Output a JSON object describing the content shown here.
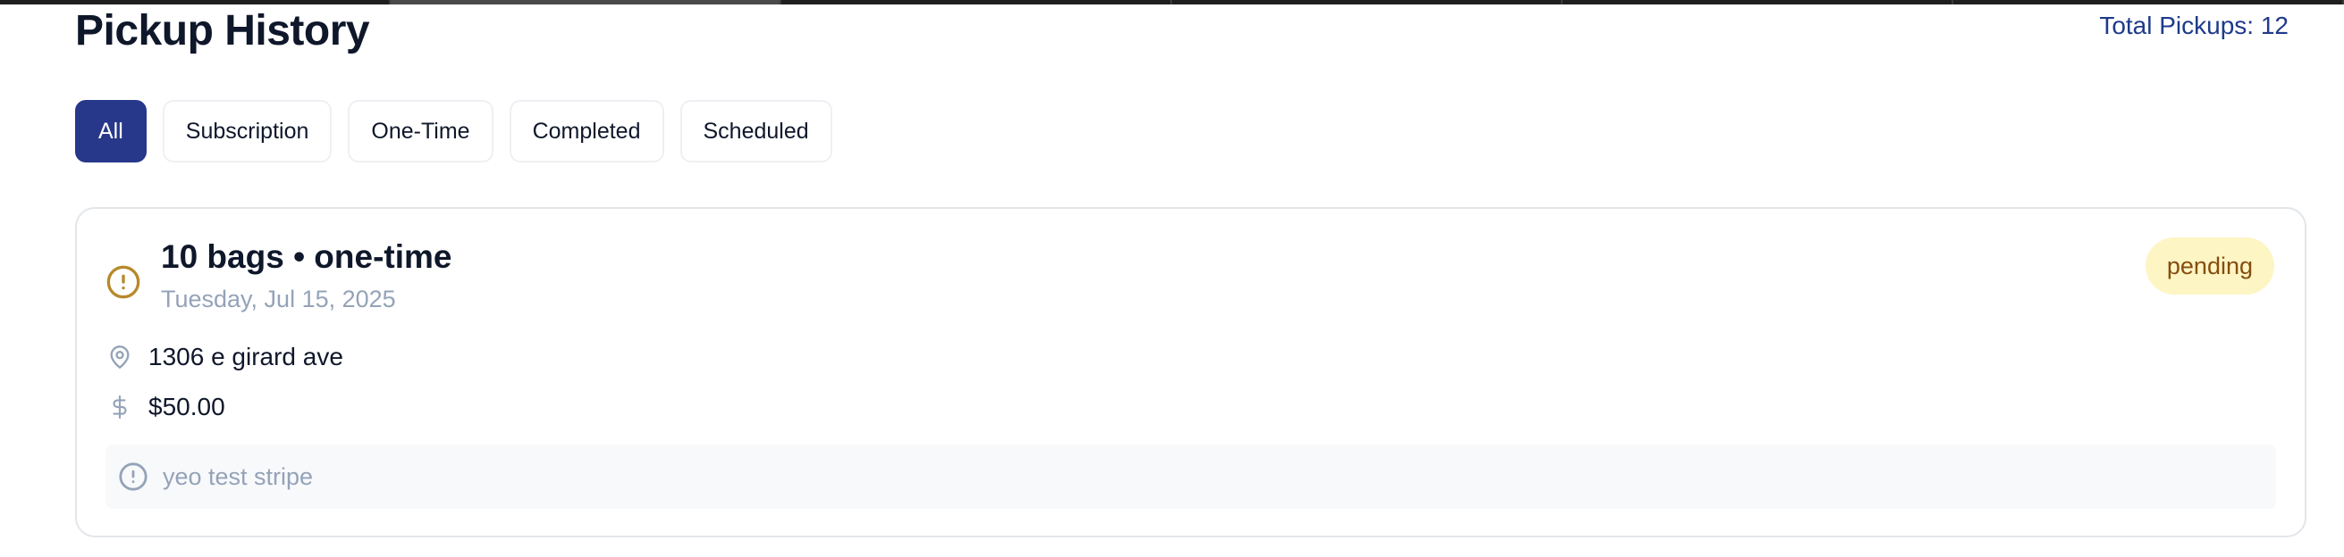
{
  "header": {
    "title": "Pickup History",
    "total_pickups": "Total Pickups: 12"
  },
  "filters": [
    "All",
    "Subscription",
    "One-Time",
    "Completed",
    "Scheduled"
  ],
  "active_filter": "All",
  "pickup": {
    "title": "10 bags • one-time",
    "date": "Tuesday, Jul 15, 2025",
    "status": "pending",
    "address": "1306 e girard ave",
    "price": "$50.00",
    "note": "yeo test stripe",
    "status_icon": "alert-circle-icon",
    "address_icon": "map-pin-icon",
    "price_icon": "dollar-sign-icon",
    "note_icon": "alert-circle-icon"
  },
  "colors": {
    "accent": "#27378a",
    "total_text": "#1e3a8a",
    "pending_badge_bg": "#fdf5c4",
    "pending_badge_text": "#854d0e",
    "pending_icon": "#b7892b",
    "muted": "#94a3b8"
  }
}
